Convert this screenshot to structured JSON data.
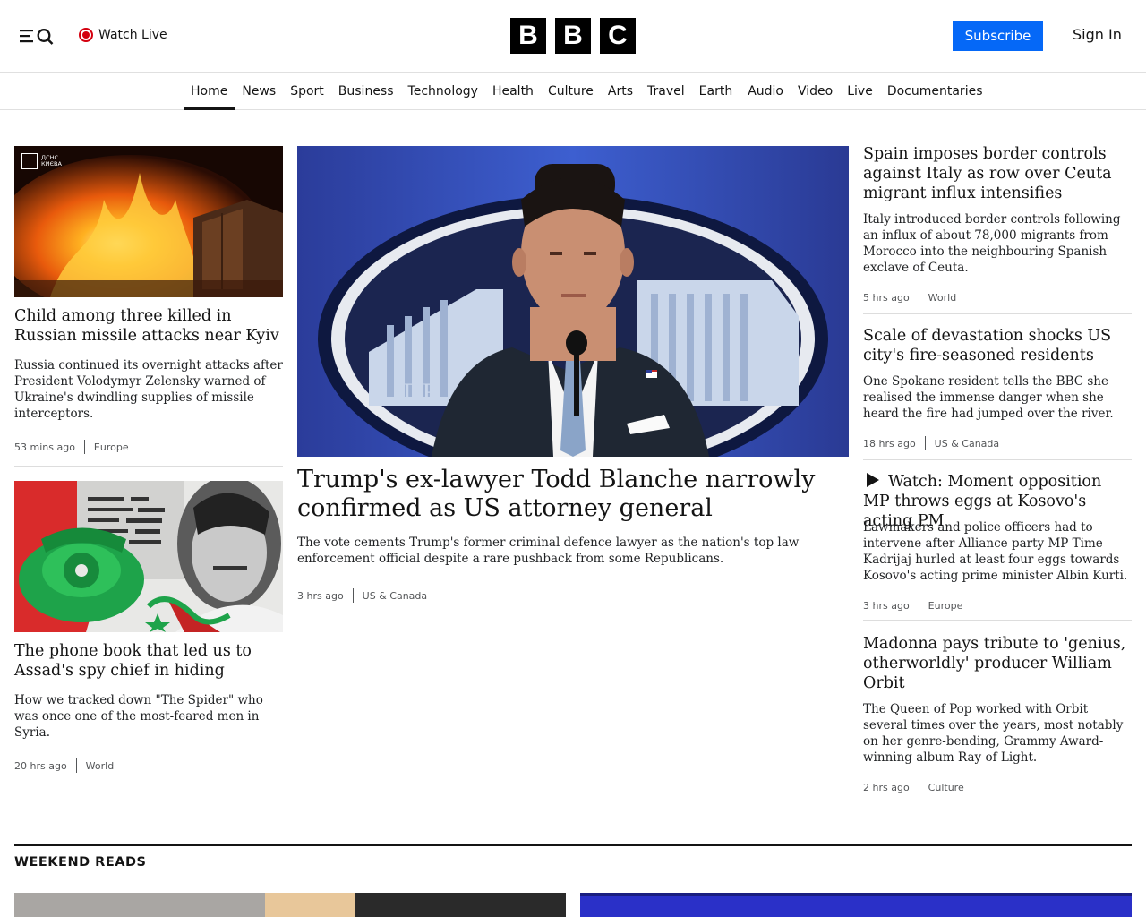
{
  "header": {
    "watch_live": "Watch Live",
    "logo_letters": [
      "B",
      "B",
      "C"
    ],
    "subscribe": "Subscribe",
    "sign_in": "Sign In"
  },
  "nav": {
    "items": [
      "Home",
      "News",
      "Sport",
      "Business",
      "Technology",
      "Health",
      "Culture",
      "Arts",
      "Travel",
      "Earth",
      "Audio",
      "Video",
      "Live",
      "Documentaries"
    ],
    "active": "Home"
  },
  "left": [
    {
      "headline": "Child among three killed in Russian missile attacks near Kyiv",
      "summary": "Russia continued its overnight attacks after President Volodymyr Zelensky warned of Ukraine's dwindling supplies of missile interceptors.",
      "time": "53 mins ago",
      "category": "Europe",
      "image_overlay": "ДСНС КИЄВА"
    },
    {
      "headline": "The phone book that led us to Assad's spy chief in hiding",
      "summary": "How we tracked down \"The Spider\" who was once one of the most-feared men in Syria.",
      "time": "20 hrs ago",
      "category": "World"
    }
  ],
  "main": {
    "headline": "Trump's ex-lawyer Todd Blanche narrowly confirmed as US attorney general",
    "summary": "The vote cements Trump's former criminal defence lawyer as the nation's top law enforcement official despite a rare pushback from some Republicans.",
    "time": "3 hrs ago",
    "category": "US & Canada",
    "image_text": "DE"
  },
  "right": [
    {
      "headline": "Spain imposes border controls against Italy as row over Ceuta migrant influx intensifies",
      "summary": "Italy introduced border controls following an influx of about 78,000 migrants from Morocco into the neighbouring Spanish exclave of Ceuta.",
      "time": "5 hrs ago",
      "category": "World"
    },
    {
      "headline": "Scale of devastation shocks US city's fire-seasoned residents",
      "summary": "One Spokane resident tells the BBC she realised the immense danger when she heard the fire had jumped over the river.",
      "time": "18 hrs ago",
      "category": "US & Canada"
    },
    {
      "headline": "Watch: Moment opposition MP throws eggs at Kosovo's acting PM",
      "summary": "Lawmakers and police officers had to intervene after Alliance party MP Time Kadrijaj hurled at least four eggs towards Kosovo's acting prime minister Albin Kurti.",
      "time": "3 hrs ago",
      "category": "Europe"
    },
    {
      "headline": "Madonna pays tribute to 'genius, otherworldly' producer William Orbit",
      "summary": "The Queen of Pop worked with Orbit several times over the years, most notably on her genre-bending, Grammy Award-winning album Ray of Light.",
      "time": "2 hrs ago",
      "category": "Culture"
    }
  ],
  "weekend": {
    "title": "WEEKEND READS"
  }
}
